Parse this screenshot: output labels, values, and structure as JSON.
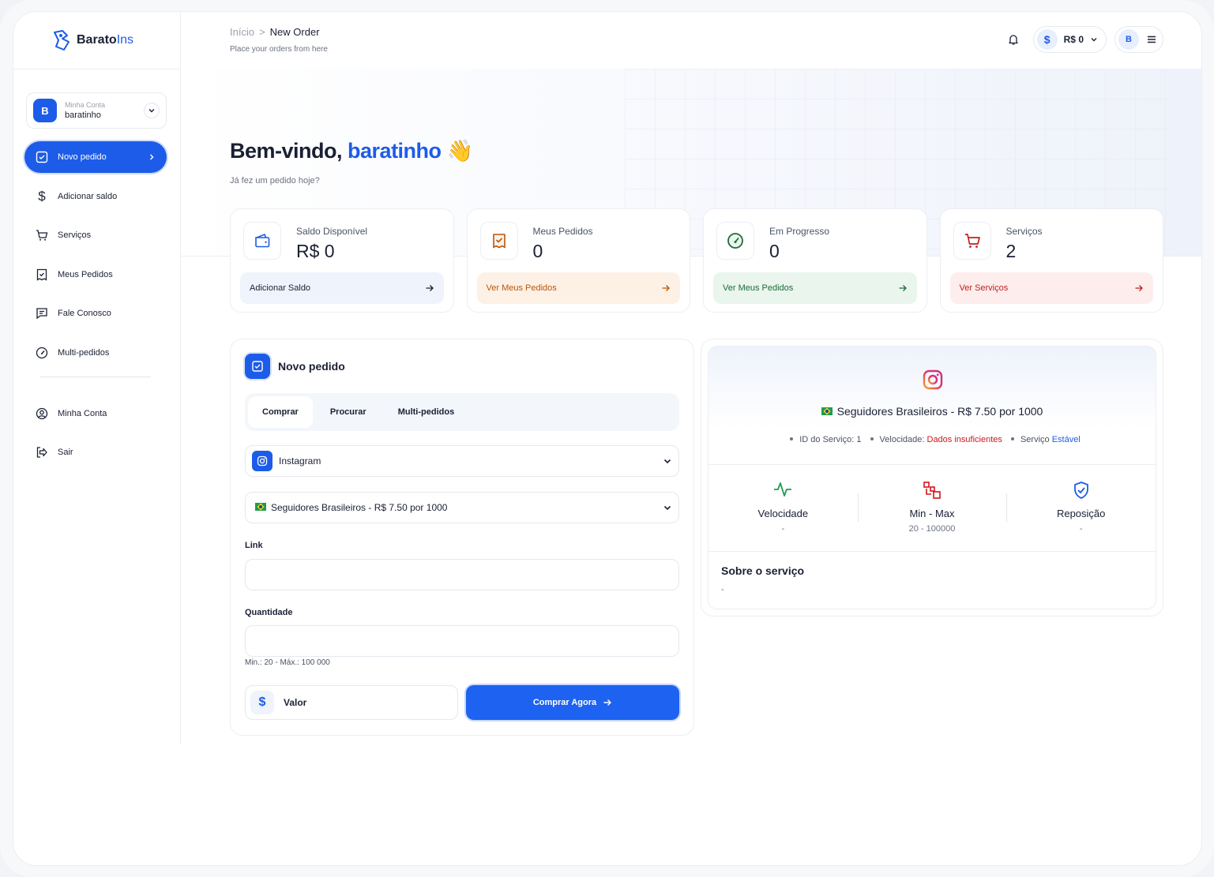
{
  "brand": {
    "name_part1": "Barato",
    "name_part2": "Ins"
  },
  "account": {
    "caption": "Minha Conta",
    "username": "baratinho",
    "initial": "B"
  },
  "sidebar": {
    "items": [
      {
        "label": "Novo pedido",
        "icon": "order-check-icon",
        "active": true
      },
      {
        "label": "Adicionar saldo",
        "icon": "dollar-icon"
      },
      {
        "label": "Serviços",
        "icon": "cart-icon"
      },
      {
        "label": "Meus Pedidos",
        "icon": "receipt-icon"
      },
      {
        "label": "Fale Conosco",
        "icon": "chat-icon"
      },
      {
        "label": "Multi-pedidos",
        "icon": "gauge-icon"
      }
    ],
    "bottom_items": [
      {
        "label": "Minha Conta",
        "icon": "user-circle-icon"
      },
      {
        "label": "Sair",
        "icon": "logout-icon"
      }
    ]
  },
  "header": {
    "breadcrumb_home": "Início",
    "breadcrumb_sep": ">",
    "breadcrumb_current": "New Order",
    "subtitle": "Place your orders from here",
    "balance": "R$ 0",
    "user_initial": "B"
  },
  "hero": {
    "greeting": "Bem-vindo,",
    "name": "baratinho",
    "emoji": "👋",
    "subtitle": "Já fez um pedido hoje?"
  },
  "stats": [
    {
      "label": "Saldo Disponível",
      "value": "R$ 0",
      "action": "Adicionar Saldo",
      "color": "#1d5ce8"
    },
    {
      "label": "Meus Pedidos",
      "value": "0",
      "action": "Ver Meus Pedidos",
      "color": "#b8560a"
    },
    {
      "label": "Em Progresso",
      "value": "0",
      "action": "Ver Meus Pedidos",
      "color": "#1f6b3a"
    },
    {
      "label": "Serviços",
      "value": "2",
      "action": "Ver Serviços",
      "color": "#c0201e"
    }
  ],
  "order_form": {
    "title": "Novo pedido",
    "tabs": [
      "Comprar",
      "Procurar",
      "Multi-pedidos"
    ],
    "active_tab": "Comprar",
    "category": "Instagram",
    "service": "Seguidores Brasileiros - R$ 7.50 por 1000",
    "link_label": "Link",
    "link_value": "",
    "quantity_label": "Quantidade",
    "quantity_value": "",
    "quantity_hint": "Min.: 20 - Máx.: 100 000",
    "value_label": "Valor",
    "buy_label": "Comprar Agora"
  },
  "service_panel": {
    "title": "Seguidores Brasileiros - R$ 7.50 por 1000",
    "id_label": "ID do Serviço: 1",
    "speed_label": "Velocidade:",
    "speed_value": "Dados insuficientes",
    "status_label": "Serviço",
    "status_value": "Estável",
    "stats": [
      {
        "title": "Velocidade",
        "value": "-",
        "icon": "activity-icon",
        "color": "#1f9d4b"
      },
      {
        "title": "Min - Max",
        "value": "20 - 100000",
        "icon": "min-max-icon",
        "color": "#d4141b"
      },
      {
        "title": "Reposição",
        "value": "-",
        "icon": "shield-check-icon",
        "color": "#1d5ce8"
      }
    ],
    "about_title": "Sobre o serviço",
    "about_value": "-"
  }
}
